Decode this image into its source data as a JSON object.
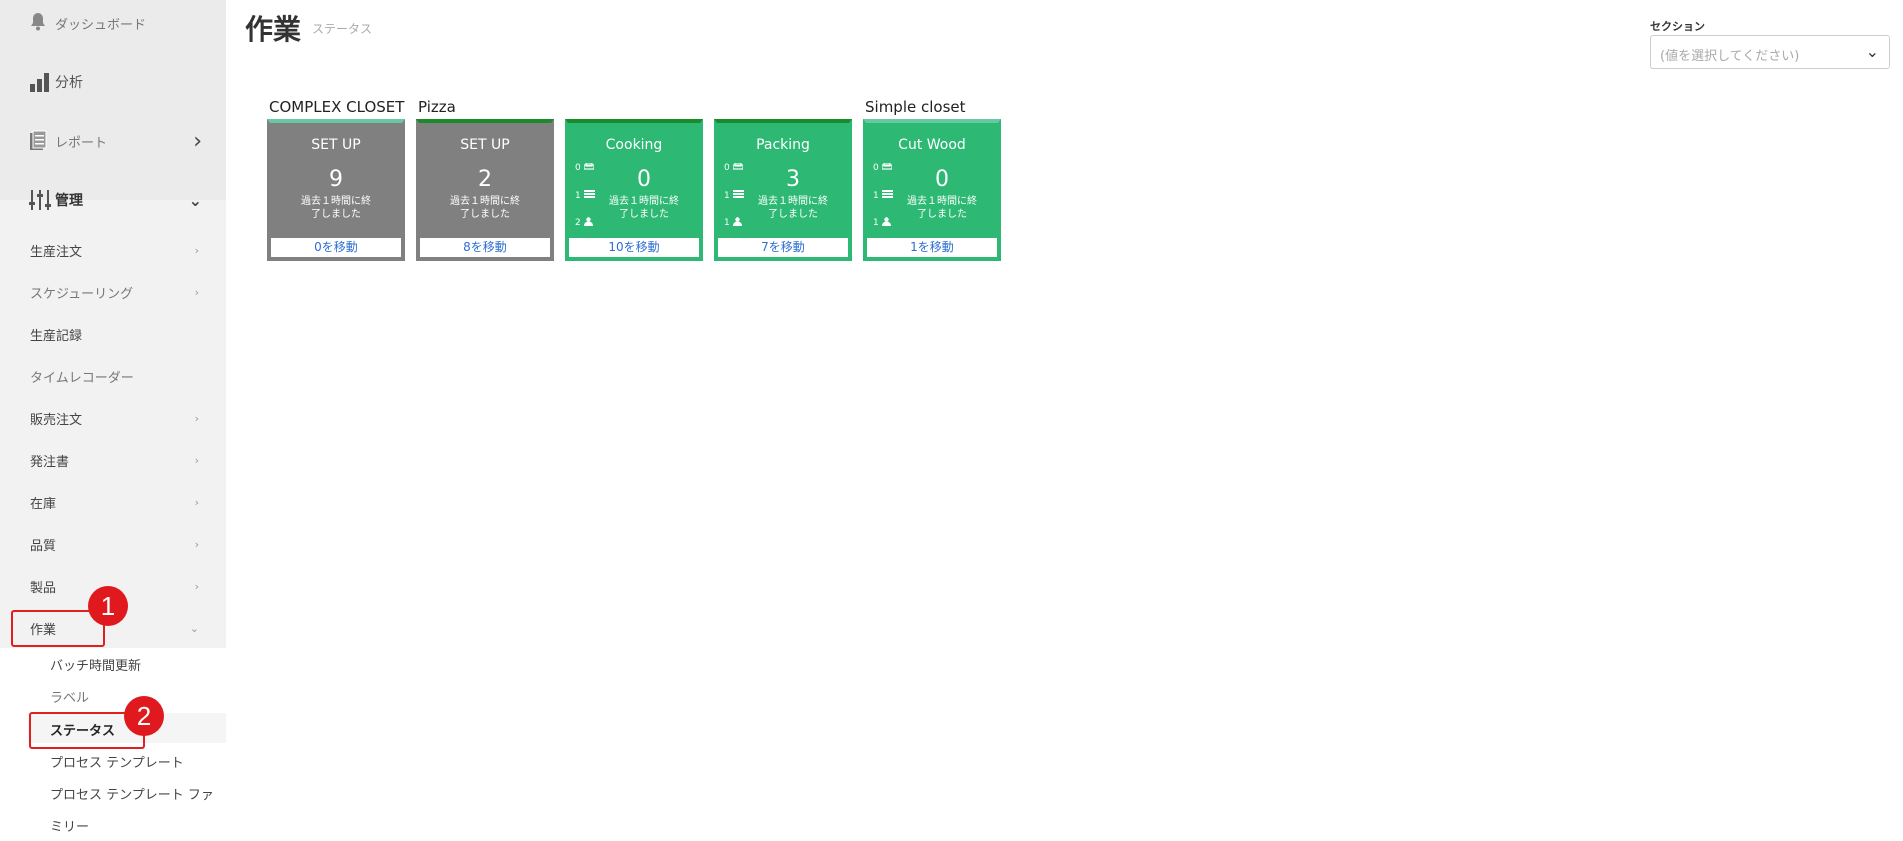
{
  "sidebar": {
    "top_items": [
      {
        "label": "ダッシュボード",
        "icon": "bell-icon"
      },
      {
        "label": "分析",
        "icon": "bar-chart-icon"
      },
      {
        "label": "レポート",
        "icon": "report-icon",
        "chevron": "›"
      },
      {
        "label": "管理",
        "icon": "sliders-icon",
        "chevron": "⌄"
      }
    ],
    "sub_items": [
      {
        "label": "生産注文",
        "chevron": "›"
      },
      {
        "label": "スケジューリング",
        "chevron": "›"
      },
      {
        "label": "生産記録"
      },
      {
        "label": "タイムレコーダー"
      },
      {
        "label": "販売注文",
        "chevron": "›"
      },
      {
        "label": "発注書",
        "chevron": "›"
      },
      {
        "label": "在庫",
        "chevron": "›"
      },
      {
        "label": "品質",
        "chevron": "›"
      },
      {
        "label": "製品",
        "chevron": "›"
      },
      {
        "label": "作業",
        "chevron": "⌄"
      }
    ],
    "children": [
      {
        "label": "バッチ時間更新"
      },
      {
        "label": "ラベル"
      },
      {
        "label": "ステータス"
      },
      {
        "label": "プロセス テンプレート"
      },
      {
        "label": "プロセス テンプレート ファ"
      },
      {
        "label": "ミリー"
      }
    ],
    "callouts": [
      "1",
      "2"
    ]
  },
  "header": {
    "title": "作業",
    "subtitle": "ステータス",
    "section_label": "セクション",
    "section_placeholder": "(値を選択してください)"
  },
  "groups": [
    "COMPLEX CLOSET",
    "Pizza",
    "Simple closet"
  ],
  "cards": [
    {
      "title": "SET UP",
      "value": "9",
      "desc1": "過去１時間に終",
      "desc2": "了しました",
      "move": "0を移動"
    },
    {
      "title": "SET UP",
      "value": "2",
      "desc1": "過去１時間に終",
      "desc2": "了しました",
      "move": "8を移動"
    },
    {
      "title": "Cooking",
      "value": "0",
      "desc1": "過去１時間に終",
      "desc2": "了しました",
      "move": "10を移動",
      "stats": [
        "0",
        "1",
        "2"
      ]
    },
    {
      "title": "Packing",
      "value": "3",
      "desc1": "過去１時間に終",
      "desc2": "了しました",
      "move": "7を移動",
      "stats": [
        "0",
        "1",
        "1"
      ]
    },
    {
      "title": "Cut Wood",
      "value": "0",
      "desc1": "過去１時間に終",
      "desc2": "了しました",
      "move": "1を移動",
      "stats": [
        "0",
        "1",
        "1"
      ]
    }
  ],
  "colors": {
    "card_gray": "#808080",
    "card_green": "#2db873",
    "accent_dark_green": "#1a8a2a",
    "link_blue": "#2e6fd1",
    "callout_red": "#e0191f"
  }
}
